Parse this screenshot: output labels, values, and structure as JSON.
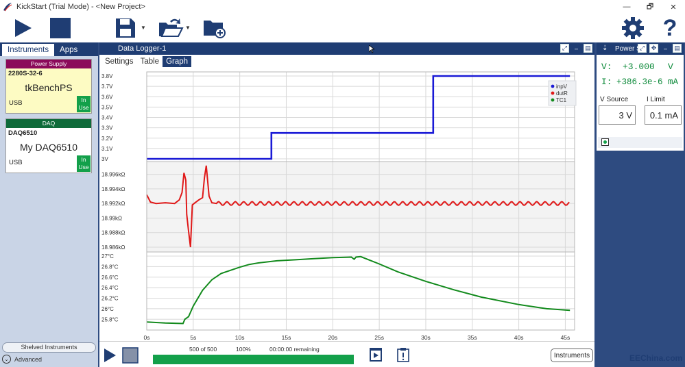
{
  "window": {
    "title": "KickStart (Trial Mode) - <New Project>",
    "controls": [
      "—",
      "🗗",
      "✕"
    ]
  },
  "toolbar": {
    "play": "play-icon",
    "stop": "stop-icon",
    "save": "save-icon",
    "open": "open-icon",
    "new_folder": "folder-plus-icon",
    "settings": "gear-icon",
    "help": "?"
  },
  "left_panel": {
    "tabs": [
      "Instruments",
      "Apps"
    ],
    "cards": [
      {
        "header": "Power Supply",
        "header_color": "#8b0a5a",
        "body_color": "#fdfbc3",
        "model": "2280S-32-6",
        "name": "tkBenchPS",
        "connection": "USB",
        "status": "In Use"
      },
      {
        "header": "DAQ",
        "header_color": "#0f6b3a",
        "body_color": "#ffffff",
        "model": "DAQ6510",
        "name": "My DAQ6510",
        "connection": "USB",
        "status": "In Use"
      }
    ],
    "shelved_label": "Shelved Instruments",
    "advanced_label": "Advanced"
  },
  "data_logger": {
    "title": "Data Logger-1",
    "tabs": [
      "Settings",
      "Table",
      "Graph"
    ],
    "active_tab": "Graph",
    "progress": {
      "count_text": "500 of 500",
      "percent_text": "100%",
      "remaining_text": "00:00:00 remaining",
      "fraction": 1.0
    },
    "instruments_button": "Instruments"
  },
  "power_supply_panel": {
    "title": "Power S",
    "v_label": "V:",
    "v_value": "+3.000",
    "v_unit": "V",
    "i_label": "I:",
    "i_value": "+386.3e-6 mA",
    "vsource_label": "V Source",
    "vsource_value": "3 V",
    "ilimit_label": "I Limit",
    "ilimit_value": "0.1 mA"
  },
  "watermark": "EEChina.com",
  "chart_data": {
    "type": "line",
    "x_tick_labels": [
      "0s",
      "5s",
      "10s",
      "15s",
      "20s",
      "25s",
      "30s",
      "35s",
      "40s",
      "45s"
    ],
    "xlim": [
      0,
      46
    ],
    "legend": {
      "entries": [
        "inpV",
        "dutR",
        "TC1"
      ],
      "placement": "top-right"
    },
    "grid": true,
    "panels": [
      {
        "series": "inpV",
        "color": "#1a1ad6",
        "tick_labels": [
          "3.8V",
          "3.7V",
          "3.6V",
          "3.5V",
          "3.4V",
          "3.3V",
          "3.2V",
          "3.1V",
          "3V"
        ],
        "ylim": [
          3.0,
          3.8
        ],
        "x": [
          0,
          13.4,
          13.4,
          30.8,
          30.8,
          45.5
        ],
        "y": [
          3.0,
          3.0,
          3.25,
          3.25,
          3.8,
          3.8
        ]
      },
      {
        "series": "dutR",
        "color": "#e01818",
        "tick_labels": [
          "18.996kΩ",
          "18.994kΩ",
          "18.992kΩ",
          "18.99kΩ",
          "18.988kΩ",
          "18.986kΩ"
        ],
        "ylim": [
          18.986,
          18.997
        ],
        "x": [
          0,
          0.4,
          1,
          2,
          3,
          3.5,
          3.8,
          4.0,
          4.2,
          4.3,
          4.5,
          4.7,
          4.9,
          5.2,
          5.6,
          6.0,
          6.2,
          6.4,
          6.7,
          7.0,
          7.5,
          8,
          45.5
        ],
        "y": [
          18.9932,
          18.9922,
          18.992,
          18.9921,
          18.992,
          18.9925,
          18.9935,
          18.9962,
          18.9952,
          18.9905,
          18.9882,
          18.986,
          18.9918,
          18.9921,
          18.9925,
          18.9928,
          18.9955,
          18.9972,
          18.993,
          18.9921,
          18.992,
          18.992,
          18.992
        ],
        "ripple_amplitude": 0.00025,
        "ripple_period": 0.9,
        "ripple_from": 7.5
      },
      {
        "series": "TC1",
        "color": "#128a1c",
        "tick_labels": [
          "27°C",
          "26.8°C",
          "26.6°C",
          "26.4°C",
          "26.2°C",
          "26°C",
          "25.8°C"
        ],
        "ylim": [
          25.7,
          27.0
        ],
        "x": [
          0,
          2,
          3.9,
          4.1,
          4.5,
          5,
          6,
          7,
          8,
          9,
          10,
          11,
          12,
          14,
          16,
          18,
          20,
          22,
          22.3,
          22.5,
          23,
          25,
          27,
          30,
          33,
          36,
          40,
          43,
          45.5
        ],
        "y": [
          25.75,
          25.73,
          25.72,
          25.8,
          25.85,
          26.05,
          26.35,
          26.55,
          26.67,
          26.73,
          26.79,
          26.84,
          26.87,
          26.91,
          26.93,
          26.95,
          26.97,
          26.98,
          26.94,
          26.98,
          26.99,
          26.85,
          26.7,
          26.52,
          26.36,
          26.22,
          26.08,
          26.0,
          25.97
        ]
      }
    ]
  }
}
